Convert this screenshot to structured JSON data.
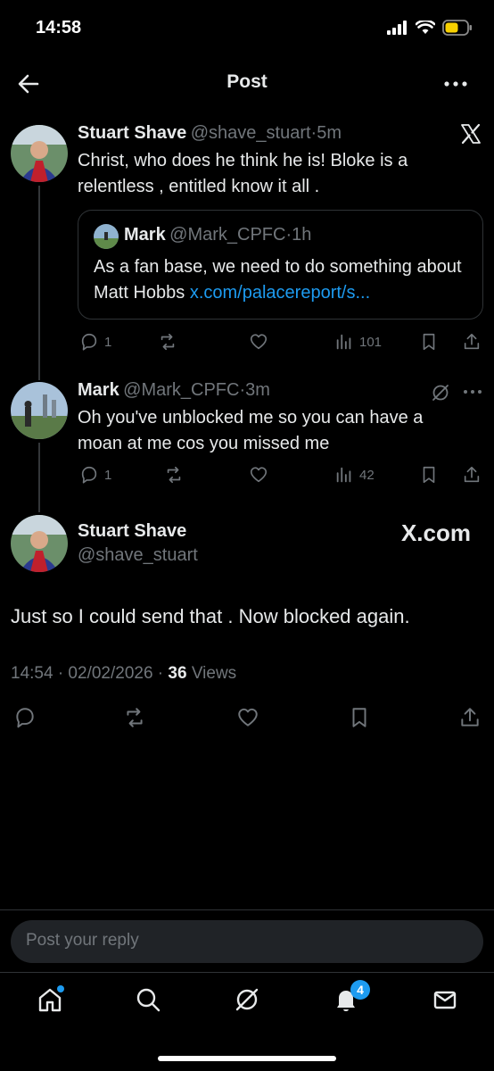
{
  "status_bar": {
    "time": "14:58"
  },
  "header": {
    "title": "Post"
  },
  "tweet1": {
    "name": "Stuart Shave",
    "handle": "@shave_stuart",
    "sep": "·",
    "time": "5m",
    "text": "Christ, who does he think he is! Bloke is a relentless , entitled know it all .",
    "quote": {
      "name": "Mark",
      "handle": "@Mark_CPFC",
      "sep": "·",
      "time": "1h",
      "text": "As a fan base, we need to do something about Matt Hobbs ",
      "link": "x.com/palacereport/s..."
    },
    "replies": "1",
    "views": "101"
  },
  "tweet2": {
    "name": "Mark",
    "handle": "@Mark_CPFC",
    "sep": "·",
    "time": "3m",
    "text": "Oh you've unblocked me so you can have a moan at me cos you missed me",
    "replies": "1",
    "views": "42"
  },
  "main_post": {
    "name": "Stuart Shave",
    "handle": "@shave_stuart",
    "watermark": "X.com",
    "text": "Just so I could send that . Now blocked again.",
    "timestamp": "14:54 · 02/02/2026 · ",
    "views_count": "36",
    "views_label": " Views"
  },
  "reply": {
    "placeholder": "Post your reply"
  },
  "tabbar": {
    "notification_count": "4"
  },
  "colors": {
    "accent": "#1d9bf0",
    "muted": "#71767b",
    "background": "#000000"
  }
}
